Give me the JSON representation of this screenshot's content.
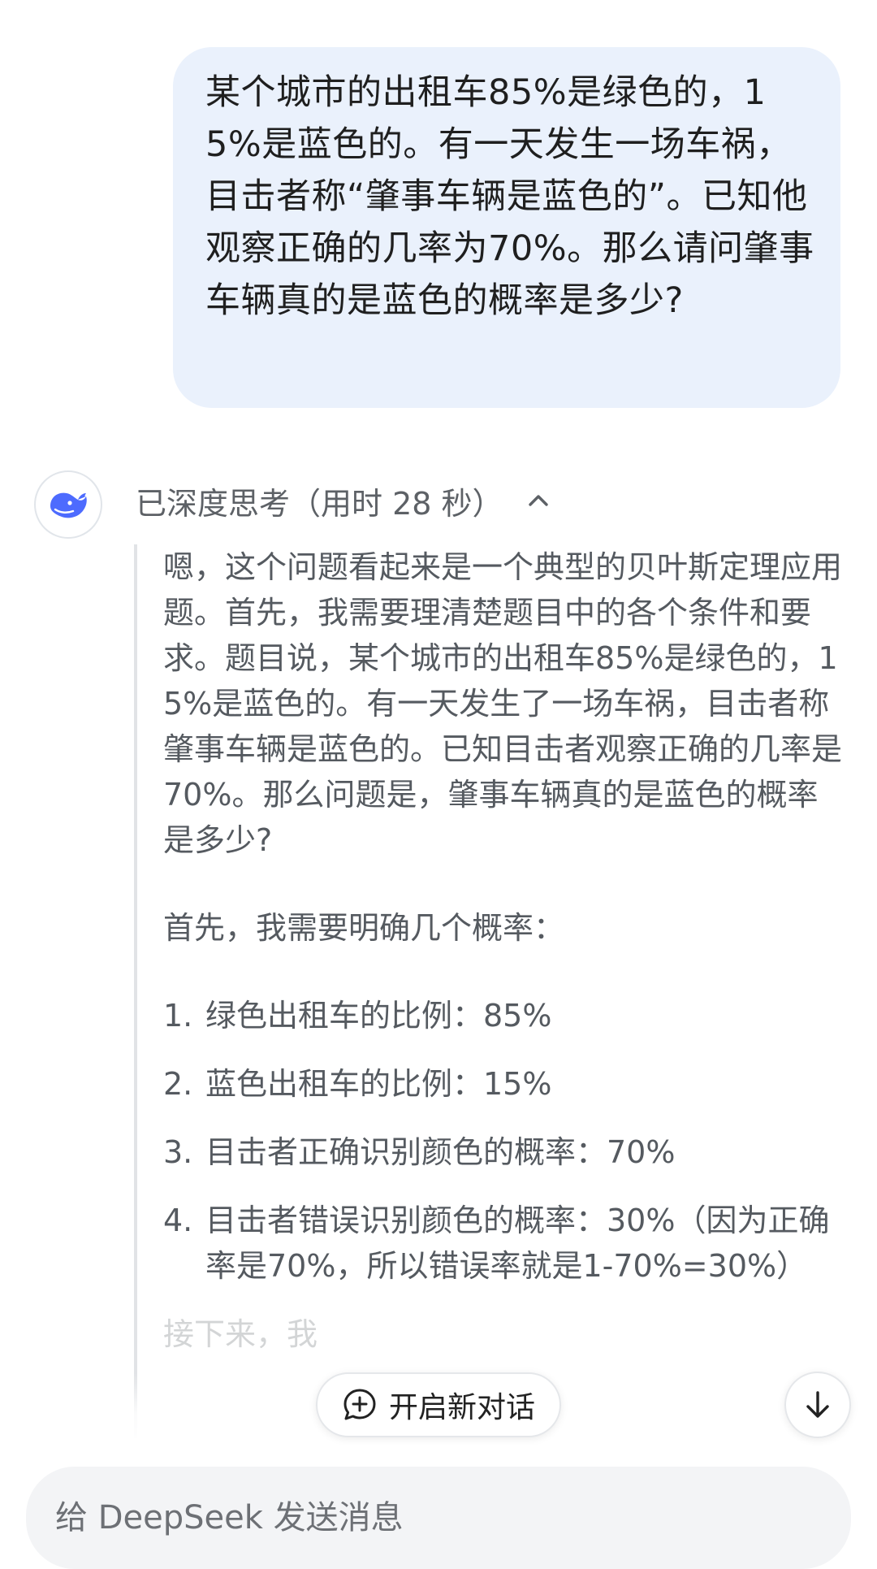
{
  "user_message": {
    "text": "某个城市的出租车85%是绿色的，15%是蓝色的。有一天发生一场车祸，目击者称“肇事车辆是蓝色的”。已知他观察正确的几率为70%。那么请问肇事车辆真的是蓝色的概率是多少?"
  },
  "assistant": {
    "avatar_icon": "deepseek-whale-icon",
    "thinking_header": "已深度思考（用时 28 秒）",
    "thinking": {
      "paragraph1": "嗯，这个问题看起来是一个典型的贝叶斯定理应用题。首先，我需要理清楚题目中的各个条件和要求。题目说，某个城市的出租车85%是绿色的，15%是蓝色的。有一天发生了一场车祸，目击者称肇事车辆是蓝色的。已知目击者观察正确的几率是70%。那么问题是，肇事车辆真的是蓝色的概率是多少?",
      "paragraph2": "首先，我需要明确几个概率：",
      "list": [
        {
          "num": "1.",
          "text": "绿色出租车的比例：85%"
        },
        {
          "num": "2.",
          "text": "蓝色出租车的比例：15%"
        },
        {
          "num": "3.",
          "text": "目击者正确识别颜色的概率：70%"
        },
        {
          "num": "4.",
          "text": "目击者错误识别颜色的概率：30%（因为正确率是70%，所以错误率就是1-70%=30%）"
        }
      ],
      "faded_line": "接下来，我"
    }
  },
  "buttons": {
    "new_chat": "开启新对话"
  },
  "input": {
    "placeholder": "给 DeepSeek 发送消息"
  },
  "colors": {
    "user_bubble_bg": "#eaf1fc",
    "brand_blue": "#4d6bfe",
    "thinking_text": "#555a60"
  }
}
